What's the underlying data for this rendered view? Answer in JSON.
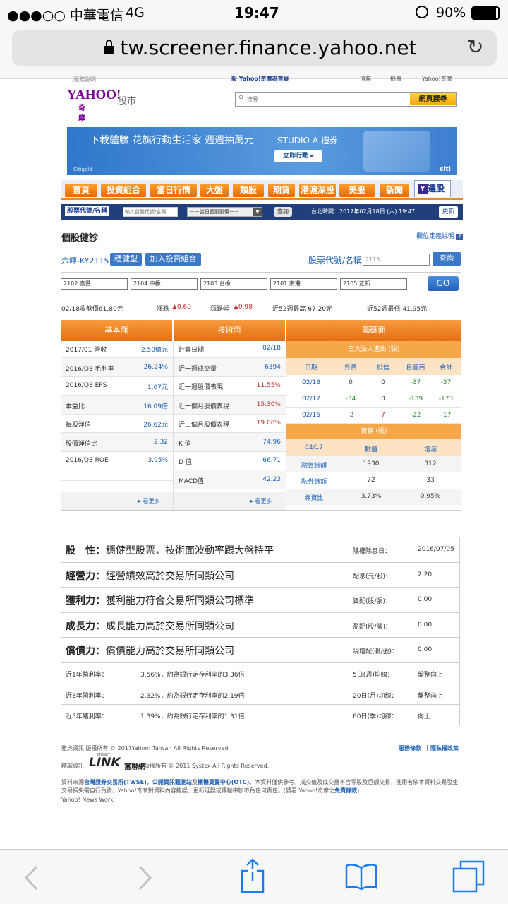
{
  "status": {
    "carrier": "●●●○○ 中華電信",
    "network": "4G",
    "time": "19:47",
    "battery": "90%"
  },
  "url": "tw.screener.finance.yahoo.net",
  "topstrip": {
    "left": "服務說明",
    "center": "設 Yahoo!奇摩為首頁",
    "r1": "信箱",
    "r2": "拍賣",
    "r3": "Yahoo!奇摩"
  },
  "logo": {
    "yahoo": "YAHOO!",
    "sub": "奇摩",
    "stock": "股市"
  },
  "search": {
    "placeholder": "搜尋",
    "button": "網頁搜尋"
  },
  "banner": {
    "title": "下載體驗 花旗行動生活家 週週抽萬元",
    "studio": "STUDIO A 禮券",
    "cta": "立即行動 ▸",
    "brand": "Citigold",
    "citi": "citi"
  },
  "nav": [
    "首頁",
    "投資組合",
    "當日行情",
    "大盤",
    "類股",
    "期貨",
    "港滬深股",
    "美股",
    "新聞"
  ],
  "nav_active": "選股",
  "subnav": {
    "code_label": "股票代號/名稱",
    "input_placeholder": "輸入台股代號/名稱",
    "select": "－－當日個股股價－－",
    "query": "查詢",
    "time": "台北時間：2017年02月18日 (六) 19:47",
    "refresh": "更新"
  },
  "page": {
    "title": "個股健診",
    "help": "欄位定義說明"
  },
  "stock": {
    "name": "六暉-KY2115",
    "type_btn": "穩健型",
    "add_btn": "加入投資組合",
    "code_label": "股票代號/名稱",
    "code_value": "2115",
    "query": "查詢"
  },
  "compare": {
    "boxes": [
      "2102 泰豐",
      "2104 中橡",
      "2103 台橡",
      "2101 南港",
      "2105 正新"
    ],
    "go": "GO"
  },
  "quote": {
    "close": "02/18收盤價61.80元",
    "chg_label": "漲跌",
    "chg": "▲0.60",
    "pct_label": "漲跌幅",
    "pct": "▲0.98",
    "high": "近52週最高 67.20元",
    "low": "近52週最低 41.95元"
  },
  "fundamental": {
    "header": "基本面",
    "rows": [
      {
        "label": "2017/01 營收",
        "value": "2.50億元"
      },
      {
        "label": "2016/Q3 毛利率",
        "value": "26.24%"
      },
      {
        "label": "2016/Q3 EPS",
        "value": "1.07元"
      },
      {
        "label": "本益比",
        "value": "16.09倍"
      },
      {
        "label": "每股淨值",
        "value": "26.62元"
      },
      {
        "label": "股價淨值比",
        "value": "2.32"
      },
      {
        "label": "2016/Q3 ROE",
        "value": "3.95%"
      }
    ],
    "more": "▸ 看更多"
  },
  "technical": {
    "header": "技術面",
    "rows": [
      {
        "label": "計算日期",
        "value": "02/18"
      },
      {
        "label": "近一週成交量",
        "value": "6394"
      },
      {
        "label": "近一週股價表現",
        "value": "11.55%"
      },
      {
        "label": "近一個月股價表現",
        "value": "15.30%"
      },
      {
        "label": "近三個月股價表現",
        "value": "19.08%"
      },
      {
        "label": "K 值",
        "value": "74.96"
      },
      {
        "label": "D 值",
        "value": "66.71"
      },
      {
        "label": "MACD值",
        "value": "42.23"
      }
    ],
    "more": "▸ 看更多"
  },
  "chips": {
    "header": "籌碼面",
    "inst_title": "三大法人進出 (張)",
    "inst_cols": [
      "日期",
      "外資",
      "投信",
      "自營商",
      "合計"
    ],
    "inst_rows": [
      [
        "02/18",
        "0",
        "0",
        "-37",
        "-37"
      ],
      [
        "02/17",
        "-34",
        "0",
        "-139",
        "-173"
      ],
      [
        "02/16",
        "-2",
        "7",
        "-22",
        "-17"
      ]
    ],
    "margin_title": "資券 (張)",
    "margin_cols": [
      "02/17",
      "數值",
      "增減"
    ],
    "margin_rows": [
      [
        "融資餘額",
        "1930",
        "312"
      ],
      [
        "融券餘額",
        "72",
        "33"
      ],
      [
        "券資比",
        "3.73%",
        "0.95%"
      ]
    ]
  },
  "summary": {
    "rows": [
      {
        "k": "股　性：",
        "v": "穩健型股票，技術面波動率跟大盤持平",
        "rk": "除權除息日：",
        "rv": "2016/07/05"
      },
      {
        "k": "經營力：",
        "v": "經營績效高於交易所同類公司",
        "rk": "配息(元/股)：",
        "rv": "2.20"
      },
      {
        "k": "獲利力：",
        "v": "獲利能力符合交易所同類公司標準",
        "rk": "資配(股/張)：",
        "rv": "0.00"
      },
      {
        "k": "成長力：",
        "v": "成長能力高於交易所同類公司",
        "rk": "盈配(股/張)：",
        "rv": "0.00"
      },
      {
        "k": "償債力：",
        "v": "償債能力高於交易所同類公司",
        "rk": "現增配(股/張)：",
        "rv": "0.00"
      }
    ],
    "rates": [
      {
        "k": "近1年殖利率：",
        "v": "3.56%，約為銀行定存利率的3.36倍",
        "rk": "5日(週)均線：",
        "rv": "盤整向上"
      },
      {
        "k": "近3年殖利率：",
        "v": "2.32%，約為銀行定存利率的2.19倍",
        "rk": "20日(月)均線：",
        "rv": "盤整向上"
      },
      {
        "k": "近5年殖利率：",
        "v": "1.39%，約為銀行定存利率的1.31倍",
        "rk": "60日(季)均線：",
        "rv": "向上"
      }
    ]
  },
  "footer": {
    "copy1": "雅虎資訊 版權所有 © 2017Yahoo! Taiwan All Rights Reserved",
    "terms": "服務條款",
    "privacy": "隱私權政策",
    "copy2_pre": "精誠資訊",
    "money": "MONEY",
    "link": "LINK",
    "fulian": "富聯網",
    "copy2_post": "版權所有 © 2011 Systex All Rights Reserved.",
    "src_pre": "資料來源",
    "twse": "台灣證券交易所(TWSE)",
    "mops": "公開資訊觀測站",
    "otc": "櫃檯買賣中心(OTC)",
    "src_post": "。本資料僅供參考，成交值及成交量不含零股及巨額交易，使用者依本資料交易發生交易損失需自行負責，Yahoo!奇摩對資料內容錯誤、更新延誤或傳輸中斷不負任何責任。(請看 Yahoo!奇摩之",
    "disclaimer": "免責條款",
    "src_end": ")",
    "news": "Yahoo! News Work"
  }
}
